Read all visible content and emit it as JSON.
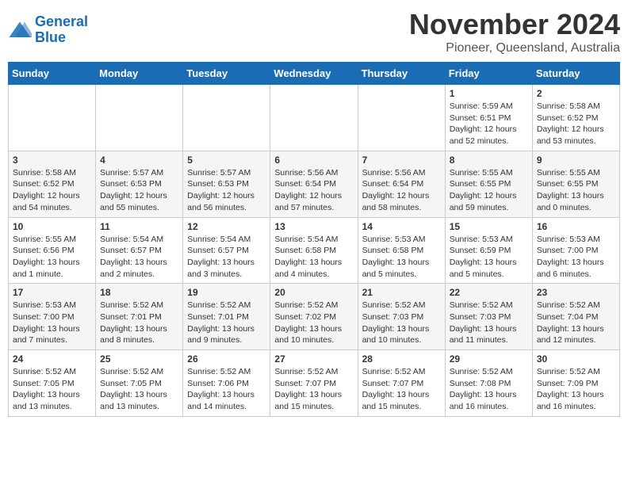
{
  "logo": {
    "line1": "General",
    "line2": "Blue"
  },
  "title": "November 2024",
  "location": "Pioneer, Queensland, Australia",
  "weekdays": [
    "Sunday",
    "Monday",
    "Tuesday",
    "Wednesday",
    "Thursday",
    "Friday",
    "Saturday"
  ],
  "weeks": [
    [
      {
        "day": "",
        "info": ""
      },
      {
        "day": "",
        "info": ""
      },
      {
        "day": "",
        "info": ""
      },
      {
        "day": "",
        "info": ""
      },
      {
        "day": "",
        "info": ""
      },
      {
        "day": "1",
        "info": "Sunrise: 5:59 AM\nSunset: 6:51 PM\nDaylight: 12 hours\nand 52 minutes."
      },
      {
        "day": "2",
        "info": "Sunrise: 5:58 AM\nSunset: 6:52 PM\nDaylight: 12 hours\nand 53 minutes."
      }
    ],
    [
      {
        "day": "3",
        "info": "Sunrise: 5:58 AM\nSunset: 6:52 PM\nDaylight: 12 hours\nand 54 minutes."
      },
      {
        "day": "4",
        "info": "Sunrise: 5:57 AM\nSunset: 6:53 PM\nDaylight: 12 hours\nand 55 minutes."
      },
      {
        "day": "5",
        "info": "Sunrise: 5:57 AM\nSunset: 6:53 PM\nDaylight: 12 hours\nand 56 minutes."
      },
      {
        "day": "6",
        "info": "Sunrise: 5:56 AM\nSunset: 6:54 PM\nDaylight: 12 hours\nand 57 minutes."
      },
      {
        "day": "7",
        "info": "Sunrise: 5:56 AM\nSunset: 6:54 PM\nDaylight: 12 hours\nand 58 minutes."
      },
      {
        "day": "8",
        "info": "Sunrise: 5:55 AM\nSunset: 6:55 PM\nDaylight: 12 hours\nand 59 minutes."
      },
      {
        "day": "9",
        "info": "Sunrise: 5:55 AM\nSunset: 6:55 PM\nDaylight: 13 hours\nand 0 minutes."
      }
    ],
    [
      {
        "day": "10",
        "info": "Sunrise: 5:55 AM\nSunset: 6:56 PM\nDaylight: 13 hours\nand 1 minute."
      },
      {
        "day": "11",
        "info": "Sunrise: 5:54 AM\nSunset: 6:57 PM\nDaylight: 13 hours\nand 2 minutes."
      },
      {
        "day": "12",
        "info": "Sunrise: 5:54 AM\nSunset: 6:57 PM\nDaylight: 13 hours\nand 3 minutes."
      },
      {
        "day": "13",
        "info": "Sunrise: 5:54 AM\nSunset: 6:58 PM\nDaylight: 13 hours\nand 4 minutes."
      },
      {
        "day": "14",
        "info": "Sunrise: 5:53 AM\nSunset: 6:58 PM\nDaylight: 13 hours\nand 5 minutes."
      },
      {
        "day": "15",
        "info": "Sunrise: 5:53 AM\nSunset: 6:59 PM\nDaylight: 13 hours\nand 5 minutes."
      },
      {
        "day": "16",
        "info": "Sunrise: 5:53 AM\nSunset: 7:00 PM\nDaylight: 13 hours\nand 6 minutes."
      }
    ],
    [
      {
        "day": "17",
        "info": "Sunrise: 5:53 AM\nSunset: 7:00 PM\nDaylight: 13 hours\nand 7 minutes."
      },
      {
        "day": "18",
        "info": "Sunrise: 5:52 AM\nSunset: 7:01 PM\nDaylight: 13 hours\nand 8 minutes."
      },
      {
        "day": "19",
        "info": "Sunrise: 5:52 AM\nSunset: 7:01 PM\nDaylight: 13 hours\nand 9 minutes."
      },
      {
        "day": "20",
        "info": "Sunrise: 5:52 AM\nSunset: 7:02 PM\nDaylight: 13 hours\nand 10 minutes."
      },
      {
        "day": "21",
        "info": "Sunrise: 5:52 AM\nSunset: 7:03 PM\nDaylight: 13 hours\nand 10 minutes."
      },
      {
        "day": "22",
        "info": "Sunrise: 5:52 AM\nSunset: 7:03 PM\nDaylight: 13 hours\nand 11 minutes."
      },
      {
        "day": "23",
        "info": "Sunrise: 5:52 AM\nSunset: 7:04 PM\nDaylight: 13 hours\nand 12 minutes."
      }
    ],
    [
      {
        "day": "24",
        "info": "Sunrise: 5:52 AM\nSunset: 7:05 PM\nDaylight: 13 hours\nand 13 minutes."
      },
      {
        "day": "25",
        "info": "Sunrise: 5:52 AM\nSunset: 7:05 PM\nDaylight: 13 hours\nand 13 minutes."
      },
      {
        "day": "26",
        "info": "Sunrise: 5:52 AM\nSunset: 7:06 PM\nDaylight: 13 hours\nand 14 minutes."
      },
      {
        "day": "27",
        "info": "Sunrise: 5:52 AM\nSunset: 7:07 PM\nDaylight: 13 hours\nand 15 minutes."
      },
      {
        "day": "28",
        "info": "Sunrise: 5:52 AM\nSunset: 7:07 PM\nDaylight: 13 hours\nand 15 minutes."
      },
      {
        "day": "29",
        "info": "Sunrise: 5:52 AM\nSunset: 7:08 PM\nDaylight: 13 hours\nand 16 minutes."
      },
      {
        "day": "30",
        "info": "Sunrise: 5:52 AM\nSunset: 7:09 PM\nDaylight: 13 hours\nand 16 minutes."
      }
    ]
  ]
}
